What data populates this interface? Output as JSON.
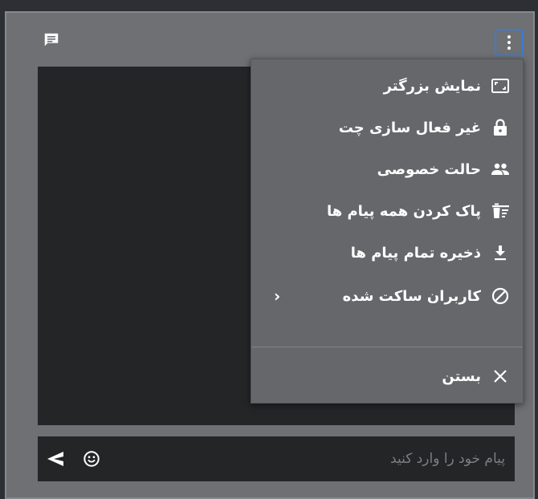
{
  "menu": {
    "items": [
      {
        "label": "نمایش بزرگتر",
        "icon": "expand-icon"
      },
      {
        "label": "غیر فعال سازی چت",
        "icon": "lock-icon"
      },
      {
        "label": "حالت خصوصی",
        "icon": "people-icon"
      },
      {
        "label": "پاک کردن همه پیام ها",
        "icon": "clear-all-icon"
      },
      {
        "label": "ذخیره تمام پیام ها",
        "icon": "download-icon"
      },
      {
        "label": "کاربران ساکت شده",
        "icon": "blocked-icon",
        "submenu_indicator": "‹"
      }
    ],
    "close_label": "بستن"
  },
  "input": {
    "placeholder": "پیام خود را وارد کنید",
    "value": ""
  },
  "colors": {
    "panel": "#6f7073",
    "chat_background": "#232527",
    "menu_background": "#66676b",
    "active_outline": "#3a7bd5"
  }
}
